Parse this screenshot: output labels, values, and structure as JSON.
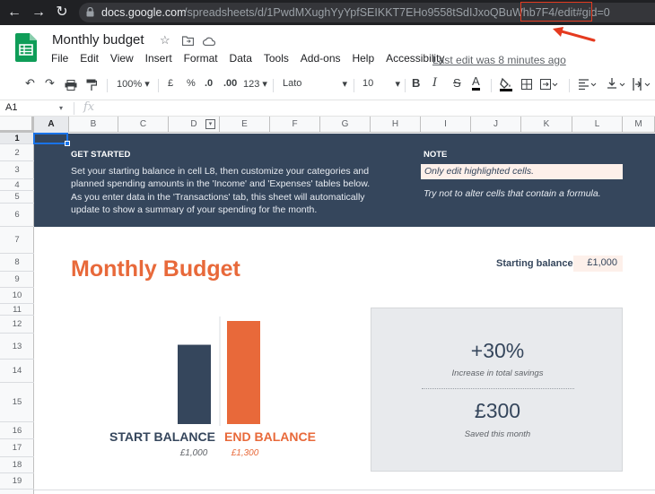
{
  "browser": {
    "url_host": "docs.google.com",
    "url_path": "/spreadsheets/d/1PwdMXughYyYpfSEIKKT7EHo9558tSdIJxoQBuWhb7F4/edit#gid=0",
    "highlight_text": "/edit#gid=0"
  },
  "doc": {
    "title": "Monthly budget",
    "menu": [
      "File",
      "Edit",
      "View",
      "Insert",
      "Format",
      "Data",
      "Tools",
      "Add-ons",
      "Help",
      "Accessibility"
    ],
    "last_edit": "Last edit was 8 minutes ago"
  },
  "toolbar": {
    "zoom": "100%",
    "currency": "£",
    "percent": "%",
    "dec_decrease": ".0",
    "dec_increase": ".00",
    "more_formats": "123",
    "font": "Lato",
    "font_size": "10",
    "bold": "B",
    "italic": "I",
    "strike": "S",
    "text_color": "A"
  },
  "formula_bar": {
    "name_box": "A1",
    "fx": "fx"
  },
  "grid": {
    "columns": [
      "A",
      "B",
      "C",
      "D",
      "E",
      "F",
      "G",
      "H",
      "I",
      "J",
      "K",
      "L",
      "M"
    ],
    "rows": [
      "1",
      "2",
      "3",
      "4",
      "5",
      "6",
      "7",
      "8",
      "9",
      "10",
      "11",
      "12",
      "13",
      "14",
      "15",
      "16",
      "17",
      "18",
      "19"
    ]
  },
  "banner": {
    "get_started_title": "GET STARTED",
    "line1": "Set your starting balance in cell L8, then customize your categories and",
    "line2": "planned spending amounts in the 'Income' and 'Expenses' tables below.",
    "line3": "As you enter data in the 'Transactions' tab, this sheet will automatically",
    "line4": "update to show a summary of your spending for the month.",
    "note_title": "NOTE",
    "note_1": "Only edit highlighted cells.",
    "note_2": "Try not to alter cells that contain a formula."
  },
  "body": {
    "title": "Monthly Budget",
    "starting_balance_label": "Starting balance:",
    "starting_balance_value": "£1,000"
  },
  "chart_data": {
    "type": "bar",
    "categories": [
      "START BALANCE",
      "END BALANCE"
    ],
    "values": [
      1000,
      1300
    ],
    "value_labels": [
      "£1,000",
      "£1,300"
    ],
    "colors": [
      "#35465c",
      "#e8693a"
    ],
    "ylim": [
      0,
      1500
    ]
  },
  "summary": {
    "savings_pct": "+30%",
    "savings_label": "Increase in total savings",
    "saved_amount": "£300",
    "saved_label": "Saved this month"
  },
  "colors": {
    "navy": "#35465c",
    "orange": "#e8693a",
    "highlight": "#fdf0ea",
    "sheets_green": "#0f9d58"
  }
}
